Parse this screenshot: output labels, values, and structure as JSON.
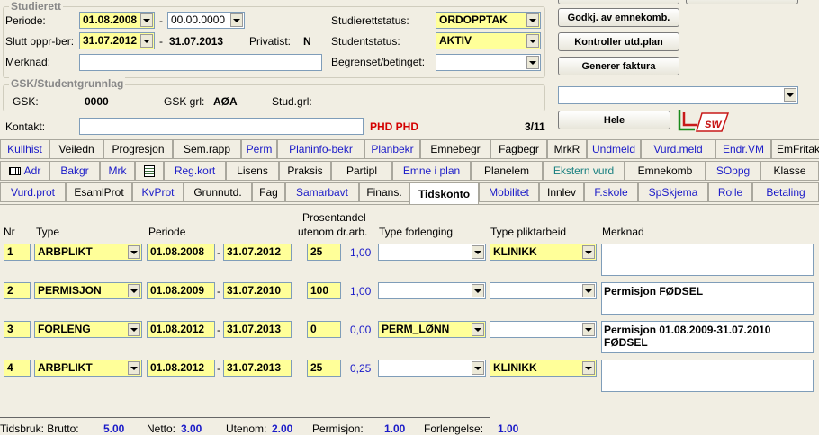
{
  "studierett": {
    "title": "Studierett",
    "periode_label": "Periode:",
    "periode_from": "01.08.2008",
    "periode_to": "00.00.0000",
    "slutt_label": "Slutt oppr-ber:",
    "slutt_value": "31.07.2012",
    "slutt_dash": "-",
    "slutt_to": "31.07.2013",
    "dash": "-",
    "privatist_label": "Privatist:",
    "privatist_value": "N",
    "merknad_label": "Merknad:",
    "merknad_value": "",
    "studierettstatus_label": "Studierettstatus:",
    "studierettstatus_value": "ORDOPPTAK",
    "studentstatus_label": "Studentstatus:",
    "studentstatus_value": "AKTIV",
    "begrenset_label": "Begrenset/betinget:",
    "begrenset_value": ""
  },
  "gsk": {
    "title": "GSK/Studentgrunnlag",
    "gsk_label": "GSK:",
    "gsk_value": "0000",
    "gsk_grl_label": "GSK grl:",
    "gsk_grl_value": "AØA",
    "stud_grl_label": "Stud.grl:",
    "stud_grl_value": ""
  },
  "kontakt": {
    "label": "Kontakt:",
    "value": "",
    "phd": "PHD PHD",
    "counter": "3/11"
  },
  "right_panel": {
    "btn1": "Godkj. av emnekomb.",
    "btn2": "Kontroller utd.plan",
    "btn3": "Generer faktura",
    "dropdown_value": "",
    "btn_hele": "Hele",
    "logo_text": "sw"
  },
  "tabs_row1": [
    "Kullhist",
    "Veiledn",
    "Progresjon",
    "Sem.rapp",
    "Perm",
    "Planinfo-bekr",
    "Planbekr",
    "Emnebegr",
    "Fagbegr",
    "MrkR",
    "Undmeld",
    "Vurd.meld",
    "Endr.VM",
    "EmFritak"
  ],
  "tabs_row2": [
    "Adr",
    "Bakgr",
    "Mrk",
    "",
    "Reg.kort",
    "Lisens",
    "Praksis",
    "Partipl",
    "Emne i plan",
    "Planelem",
    "Ekstern vurd",
    "Emnekomb",
    "SOppg",
    "Klasse"
  ],
  "tabs_row3": [
    "Vurd.prot",
    "EsamlProt",
    "KvProt",
    "Grunnutd.",
    "Fag",
    "Samarbavt",
    "Finans.",
    "Tidskonto",
    "Mobilitet",
    "Innlev",
    "F.skole",
    "SpSkjema",
    "Rolle",
    "Betaling"
  ],
  "table": {
    "headers": {
      "nr": "Nr",
      "type": "Type",
      "periode": "Periode",
      "prosent_line1": "Prosentandel",
      "prosent_line2": "utenom dr.arb.",
      "type_forlenging": "Type forlenging",
      "type_plikt": "Type pliktarbeid",
      "merknad": "Merknad"
    },
    "rows": [
      {
        "nr": "1",
        "type": "ARBPLIKT",
        "from": "01.08.2008",
        "to": "31.07.2012",
        "pct": "25",
        "ratio": "1,00",
        "forlenging": "",
        "plikt": "KLINIKK",
        "merknad": ""
      },
      {
        "nr": "2",
        "type": "PERMISJON",
        "from": "01.08.2009",
        "to": "31.07.2010",
        "pct": "100",
        "ratio": "1,00",
        "forlenging": "",
        "plikt": "",
        "merknad": "Permisjon FØDSEL"
      },
      {
        "nr": "3",
        "type": "FORLENG",
        "from": "01.08.2012",
        "to": "31.07.2013",
        "pct": "0",
        "ratio": "0,00",
        "forlenging": "PERM_LØNN",
        "plikt": "",
        "merknad": "Permisjon 01.08.2009-31.07.2010 FØDSEL"
      },
      {
        "nr": "4",
        "type": "ARBPLIKT",
        "from": "01.08.2012",
        "to": "31.07.2013",
        "pct": "25",
        "ratio": "0,25",
        "forlenging": "",
        "plikt": "KLINIKK",
        "merknad": ""
      }
    ]
  },
  "status_bar": {
    "tidsbruk_label": "Tidsbruk: Brutto:",
    "brutto": "5.00",
    "netto_label": "Netto:",
    "netto": "3.00",
    "utenom_label": "Utenom:",
    "utenom": "2.00",
    "permisjon_label": "Permisjon:",
    "permisjon": "1.00",
    "forlengelse_label": "Forlengelse:",
    "forlengelse": "1.00"
  }
}
